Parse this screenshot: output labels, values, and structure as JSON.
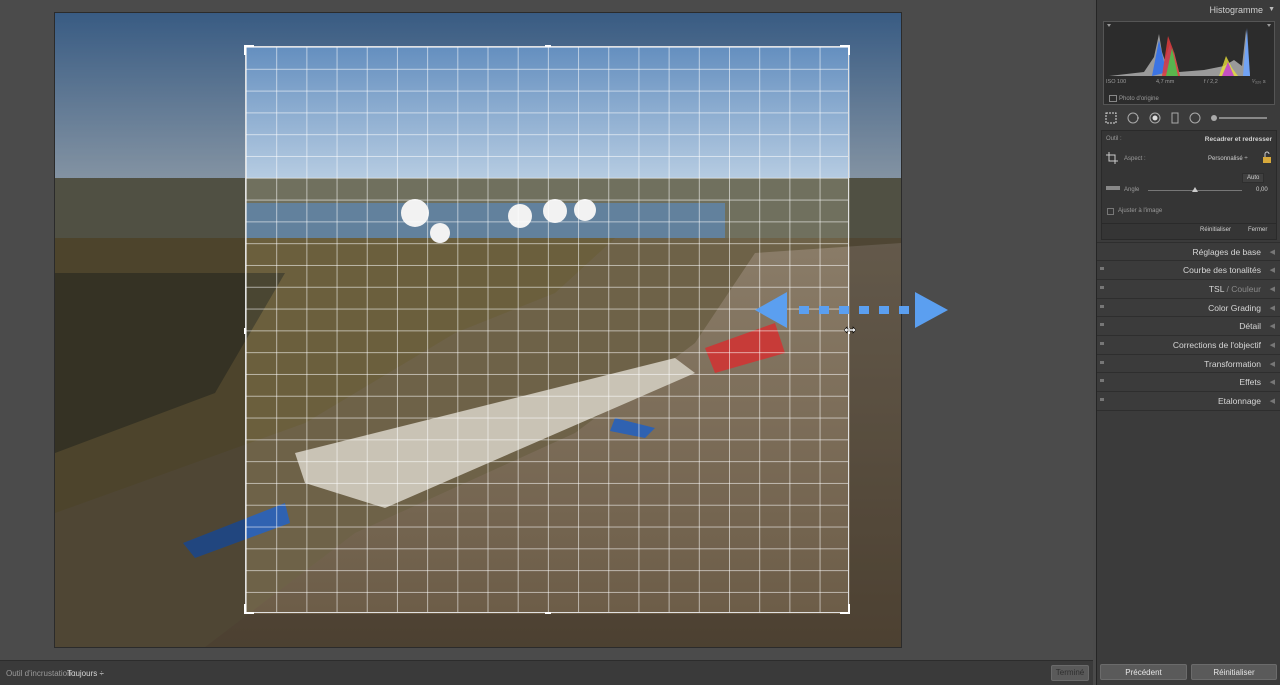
{
  "bottom_bar": {
    "overlay_label": "Outil d'incrustation :",
    "overlay_value": "Toujours ÷",
    "done_label": "Terminé"
  },
  "histogram": {
    "title": "Histogramme",
    "iso": "ISO 100",
    "focal": "4,7 mm",
    "aperture": "f / 2,2",
    "shutter": "¹⁄₃₂₀ s",
    "original_photo": "Photo d'origine"
  },
  "tool_panel": {
    "tool_label": "Outil :",
    "tool_name": "Recadrer et redresser",
    "aspect_label": "Aspect :",
    "aspect_value": "Personnalisé ÷",
    "auto_label": "Auto",
    "angle_label": "Angle",
    "angle_value": "0,00",
    "fit_label": "Ajuster à l'image",
    "reset_label": "Réinitialiser",
    "close_label": "Fermer"
  },
  "sections": [
    {
      "label": "Réglages de base"
    },
    {
      "label": "Courbe des tonalités"
    },
    {
      "label": "TSL",
      "extra": " / Couleur"
    },
    {
      "label": "Color Grading"
    },
    {
      "label": "Détail"
    },
    {
      "label": "Corrections de l'objectif"
    },
    {
      "label": "Transformation"
    },
    {
      "label": "Effets"
    },
    {
      "label": "Etalonnage"
    }
  ],
  "footer": {
    "previous_label": "Précédent",
    "reset_label": "Réinitialiser"
  },
  "colors": {
    "accent_arrow": "#5b9ff0",
    "panel_bg": "#3b3b3b"
  }
}
